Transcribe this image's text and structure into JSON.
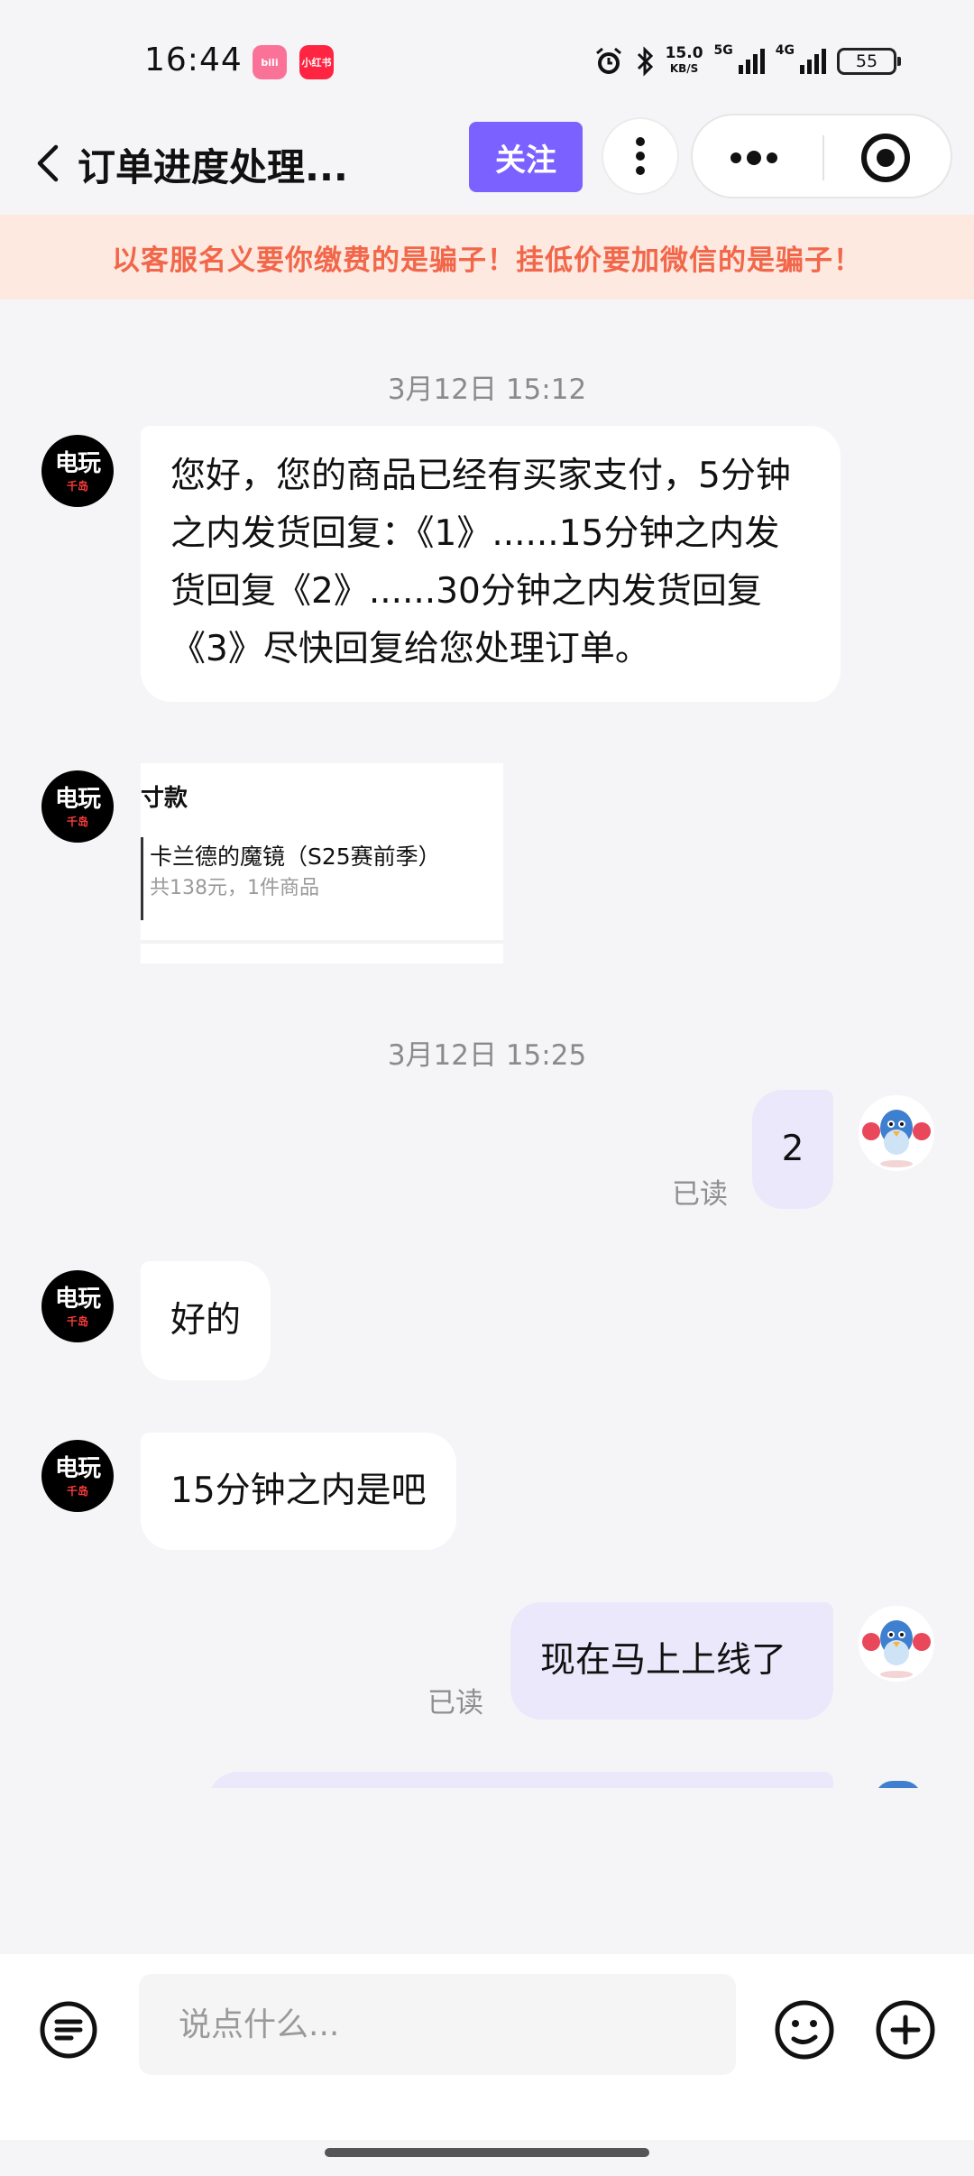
{
  "status_bar": {
    "time": "16:44",
    "apps": [
      "bilibili",
      "小红书"
    ],
    "net_speed_value": "15.0",
    "net_speed_unit": "KB/S",
    "sim1_label": "5G",
    "sim2_label": "4G",
    "battery": "55"
  },
  "header": {
    "title": "订单进度处理...",
    "follow_label": "关注"
  },
  "warning_text": "以客服名义要你缴费的是骗子！挂低价要加微信的是骗子！",
  "shop_avatar": {
    "line1": "电玩",
    "line2": "千岛"
  },
  "messages": {
    "ts1": "3月12日 15:12",
    "m1": "您好，您的商品已经有买家支付，5分钟之内发货回复：《1》......15分钟之内发货回复《2》......30分钟之内发货回复《3》尽快回复给您处理订单。",
    "card": {
      "heading": "寸款",
      "item": "卡兰德的魔镜（S25赛前季）",
      "summary": "共138元，1件商品"
    },
    "ts2": "3月12日 15:25",
    "m2": "2",
    "m2_status": "已读",
    "m3": "好的",
    "m4": "15分钟之内是吧",
    "m5": "现在马上上线了",
    "m5_status": "已读"
  },
  "input": {
    "placeholder": "说点什么..."
  },
  "colors": {
    "accent": "#7b61ff",
    "warning_text": "#f2664a",
    "warning_bg": "#fde9df",
    "out_bubble": "#ebe8fb"
  }
}
